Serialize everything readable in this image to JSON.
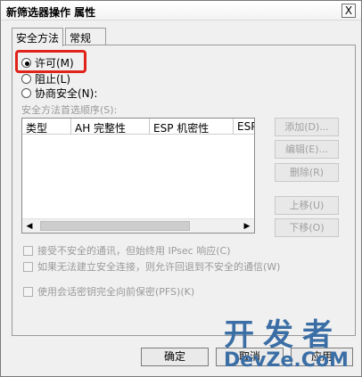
{
  "window": {
    "title": "新筛选器操作 属性",
    "close_glyph": "X"
  },
  "tabs": [
    {
      "label": "安全方法"
    },
    {
      "label": "常规"
    }
  ],
  "radios": [
    {
      "label": "许可(M)",
      "checked": true
    },
    {
      "label": "阻止(L)",
      "checked": false
    },
    {
      "label": "协商安全(N):",
      "checked": false
    }
  ],
  "security_methods": {
    "label": "安全方法首选顺序(S):",
    "columns": [
      "类型",
      "AH 完整性",
      "ESP 机密性",
      "ESP"
    ],
    "rows": []
  },
  "side_buttons": {
    "add": "添加(D)...",
    "edit": "编辑(E)...",
    "remove": "删除(R)",
    "move_up": "上移(U)",
    "move_down": "下移(O)"
  },
  "checkboxes": [
    {
      "label": "接受不安全的通讯，但始终用 IPsec 响应(C)",
      "checked": false
    },
    {
      "label": "如果无法建立安全连接，则允许回退到不安全的通信(W)",
      "checked": false
    },
    {
      "label": "使用会话密钥完全向前保密(PFS)(K)",
      "checked": false
    }
  ],
  "dialog_buttons": {
    "ok": "确定",
    "cancel": "取消",
    "apply": "应用"
  },
  "scrollbar": {
    "left_arrow": "◀",
    "right_arrow": "▶"
  },
  "watermark": {
    "line1": "开发者",
    "line2": "DevZe.CoM"
  },
  "colors": {
    "highlight": "#e0231b",
    "watermark": "#3a6ea5"
  }
}
